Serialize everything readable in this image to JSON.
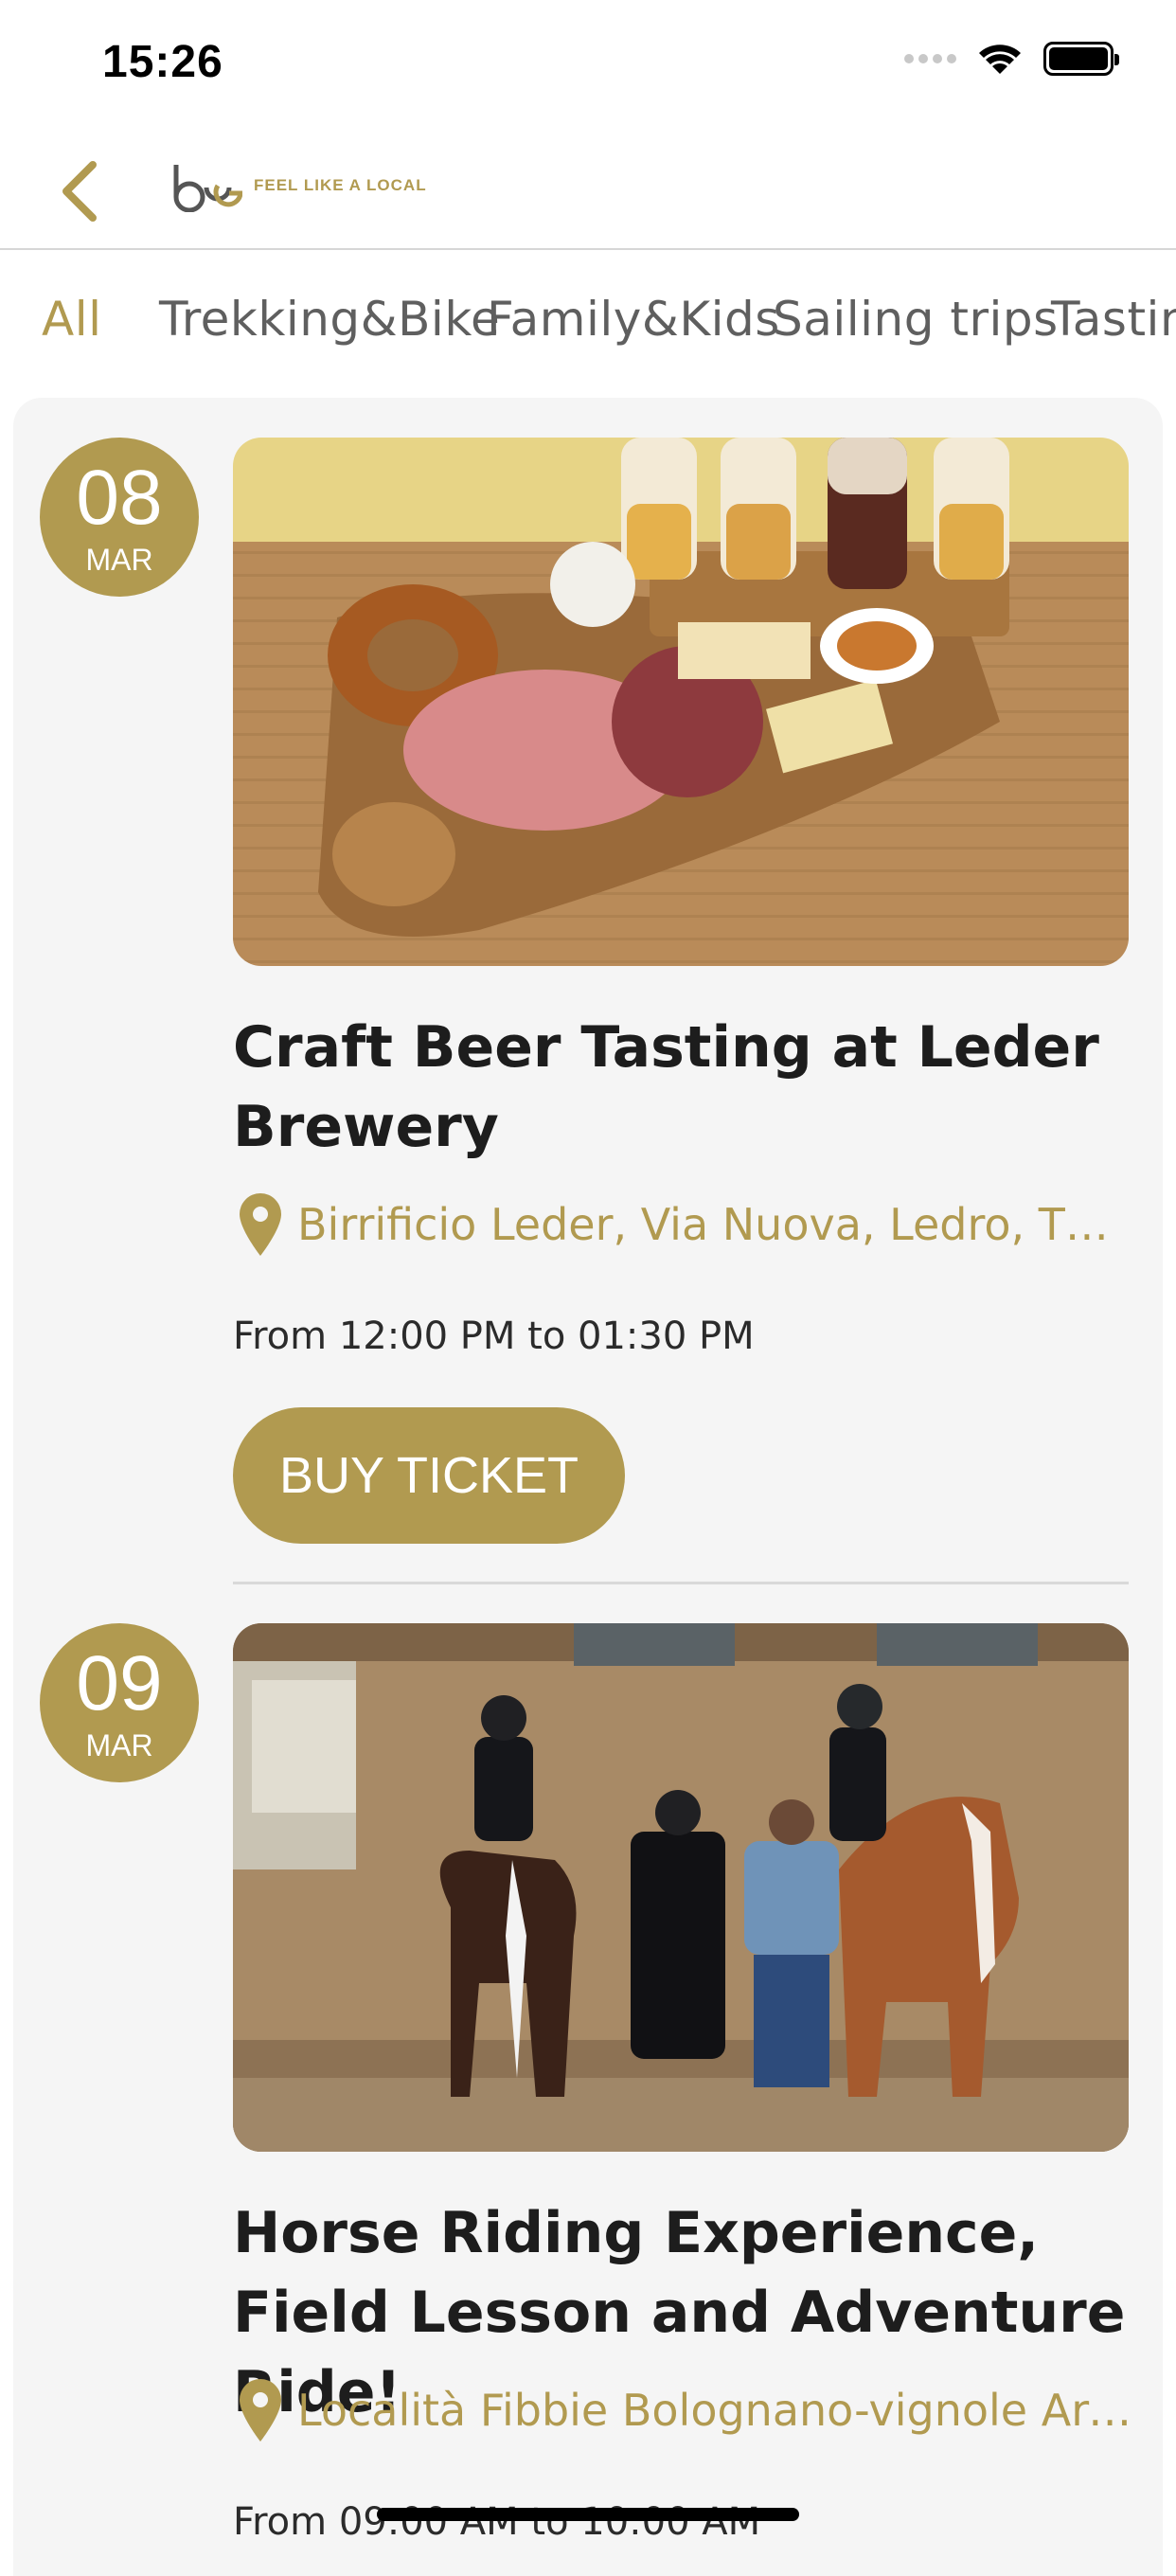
{
  "status": {
    "time": "15:26"
  },
  "nav": {
    "logo_text": "FEEL LIKE A LOCAL",
    "back_icon": "chevron-left-icon"
  },
  "tabs": [
    {
      "label": "All",
      "active": true
    },
    {
      "label": "Trekking&Bike"
    },
    {
      "label": "Family&Kids"
    },
    {
      "label": "Sailing trips"
    },
    {
      "label": "Tasting"
    }
  ],
  "events": [
    {
      "day": "08",
      "month": "MAR",
      "title": "Craft Beer Tasting at Leder Brewery",
      "location": "Birrificio Leder, Via Nuova, Ledro, TN,...",
      "time": "From 12:00 PM to 01:30 PM",
      "button": "BUY TICKET"
    },
    {
      "day": "09",
      "month": "MAR",
      "title": "Horse Riding Experience, Field Lesson and Adventure Ride!",
      "location": "Località Fibbie Bolognano-vignole Arco",
      "time": "From 09:00 AM to 10:00 AM"
    }
  ],
  "colors": {
    "accent": "#b19a50",
    "panel": "#f5f5f5"
  }
}
